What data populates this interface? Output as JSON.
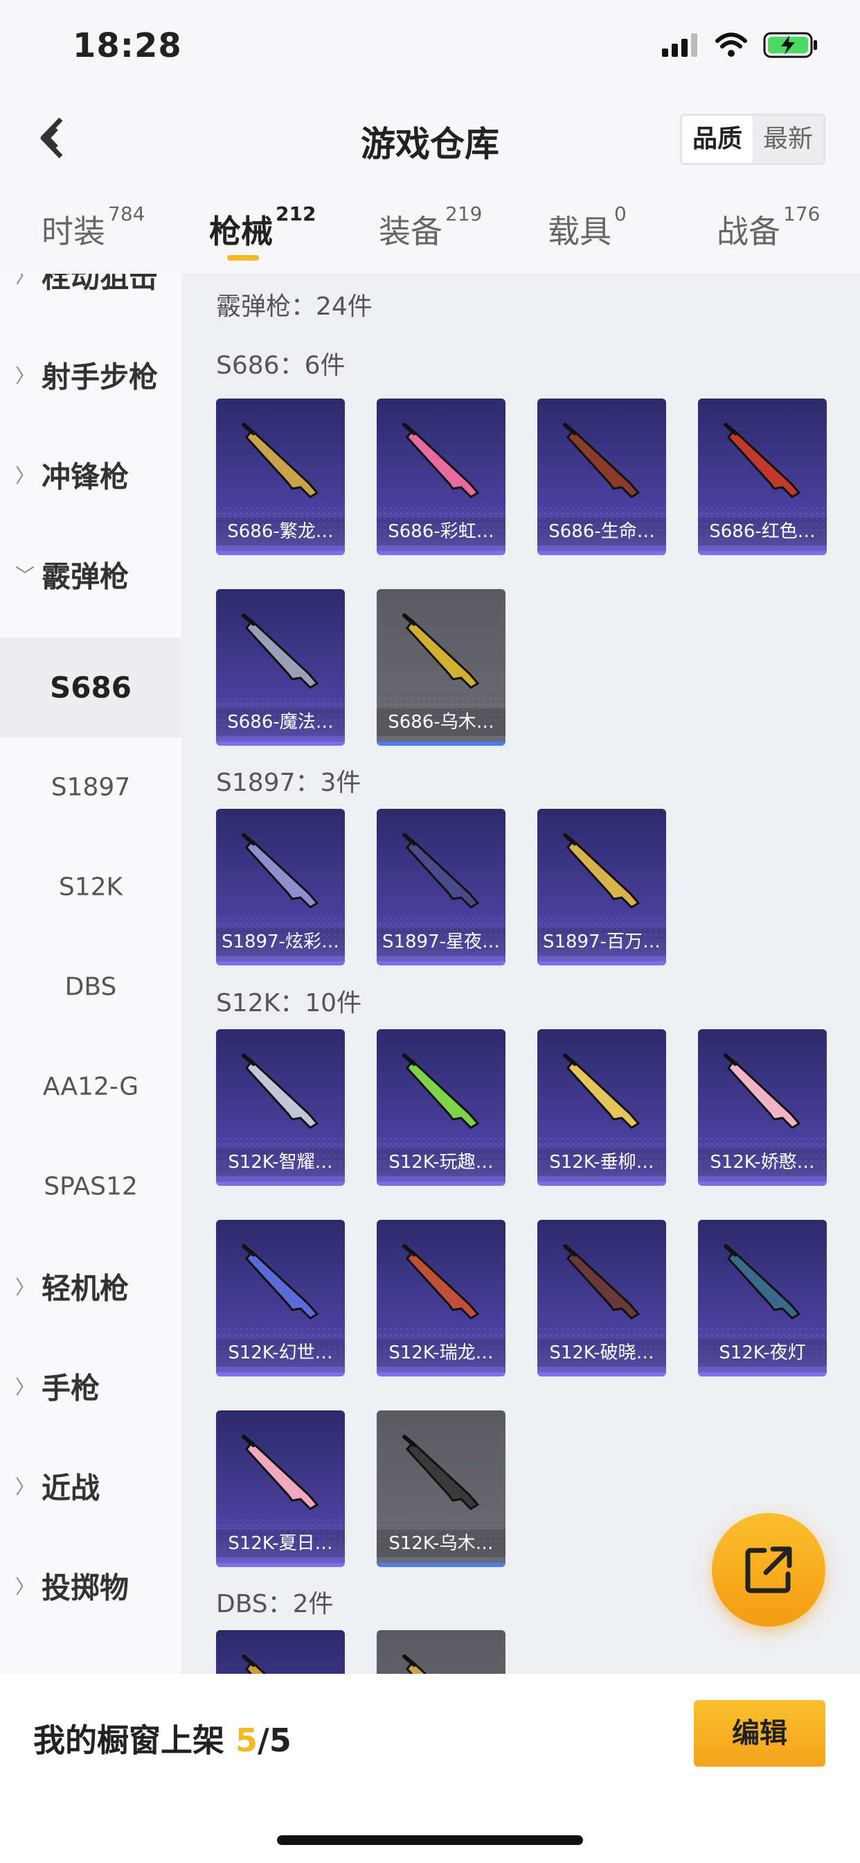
{
  "status_bar": {
    "time": "18:28"
  },
  "header": {
    "title": "游戏仓库",
    "sort_options": [
      "品质",
      "最新"
    ],
    "selected_sort": "品质"
  },
  "tabs": [
    {
      "label": "时装",
      "count": "784"
    },
    {
      "label": "枪械",
      "count": "212"
    },
    {
      "label": "装备",
      "count": "219"
    },
    {
      "label": "载具",
      "count": "0"
    },
    {
      "label": "战备",
      "count": "176"
    }
  ],
  "sidebar": {
    "categories_top": [
      "栓动狙击",
      "射手步枪",
      "冲锋枪",
      "霰弹枪"
    ],
    "subitems": [
      "S686",
      "S1897",
      "S12K",
      "DBS",
      "AA12-G",
      "SPAS12"
    ],
    "selected_subitem": "S686",
    "categories_bottom": [
      "轻机枪",
      "手枪",
      "近战",
      "投掷物"
    ]
  },
  "main": {
    "category_title": "霰弹枪：24件",
    "groups": [
      {
        "title": "S686：6件",
        "items": [
          "S686-繁龙…",
          "S686-彩虹…",
          "S686-生命…",
          "S686-红色…",
          "S686-魔法…",
          "S686-乌木…"
        ]
      },
      {
        "title": "S1897：3件",
        "items": [
          "S1897-炫彩…",
          "S1897-星夜…",
          "S1897-百万…"
        ]
      },
      {
        "title": "S12K：10件",
        "items": [
          "S12K-智耀…",
          "S12K-玩趣…",
          "S12K-垂柳…",
          "S12K-娇憨…",
          "S12K-幻世…",
          "S12K-瑞龙…",
          "S12K-破晓…",
          "S12K-夜灯",
          "S12K-夏日…",
          "S12K-乌木…"
        ]
      },
      {
        "title": "DBS：2件",
        "items": [
          "",
          ""
        ]
      }
    ]
  },
  "bottom": {
    "shelf_label": "我的橱窗上架 ",
    "shelf_current": "5",
    "shelf_total": "/5",
    "edit_label": "编辑"
  },
  "colors": {
    "accent": "#f5b81f",
    "card_purple": "#4a3f9c",
    "card_gray": "#5a5b61"
  }
}
